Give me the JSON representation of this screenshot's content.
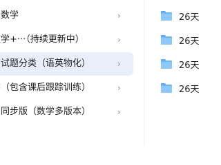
{
  "sidebar": {
    "items": [
      {
        "label": "中数学",
        "chevron": "›",
        "active": false
      },
      {
        "label": "数学+···（持续更新中）",
        "chevron": "›",
        "active": false
      },
      {
        "label": "考试题分类（语英物化）",
        "chevron": "›",
        "active": true
      },
      {
        "label": "学（包含课后跟踪训练）",
        "chevron": "›",
        "active": false
      },
      {
        "label": "中同步版（数学多版本）",
        "chevron": "›",
        "active": false
      }
    ]
  },
  "files": {
    "items": [
      {
        "label": "26天",
        "icon": "folder-icon"
      },
      {
        "label": "26天",
        "icon": "folder-icon"
      },
      {
        "label": "26天",
        "icon": "folder-icon"
      },
      {
        "label": "26天",
        "icon": "folder-icon"
      }
    ]
  },
  "colors": {
    "active_bg": "#e8effb",
    "folder": "#6cb6f5",
    "text": "#1f1f1f",
    "chevron": "#8c8c8c"
  }
}
